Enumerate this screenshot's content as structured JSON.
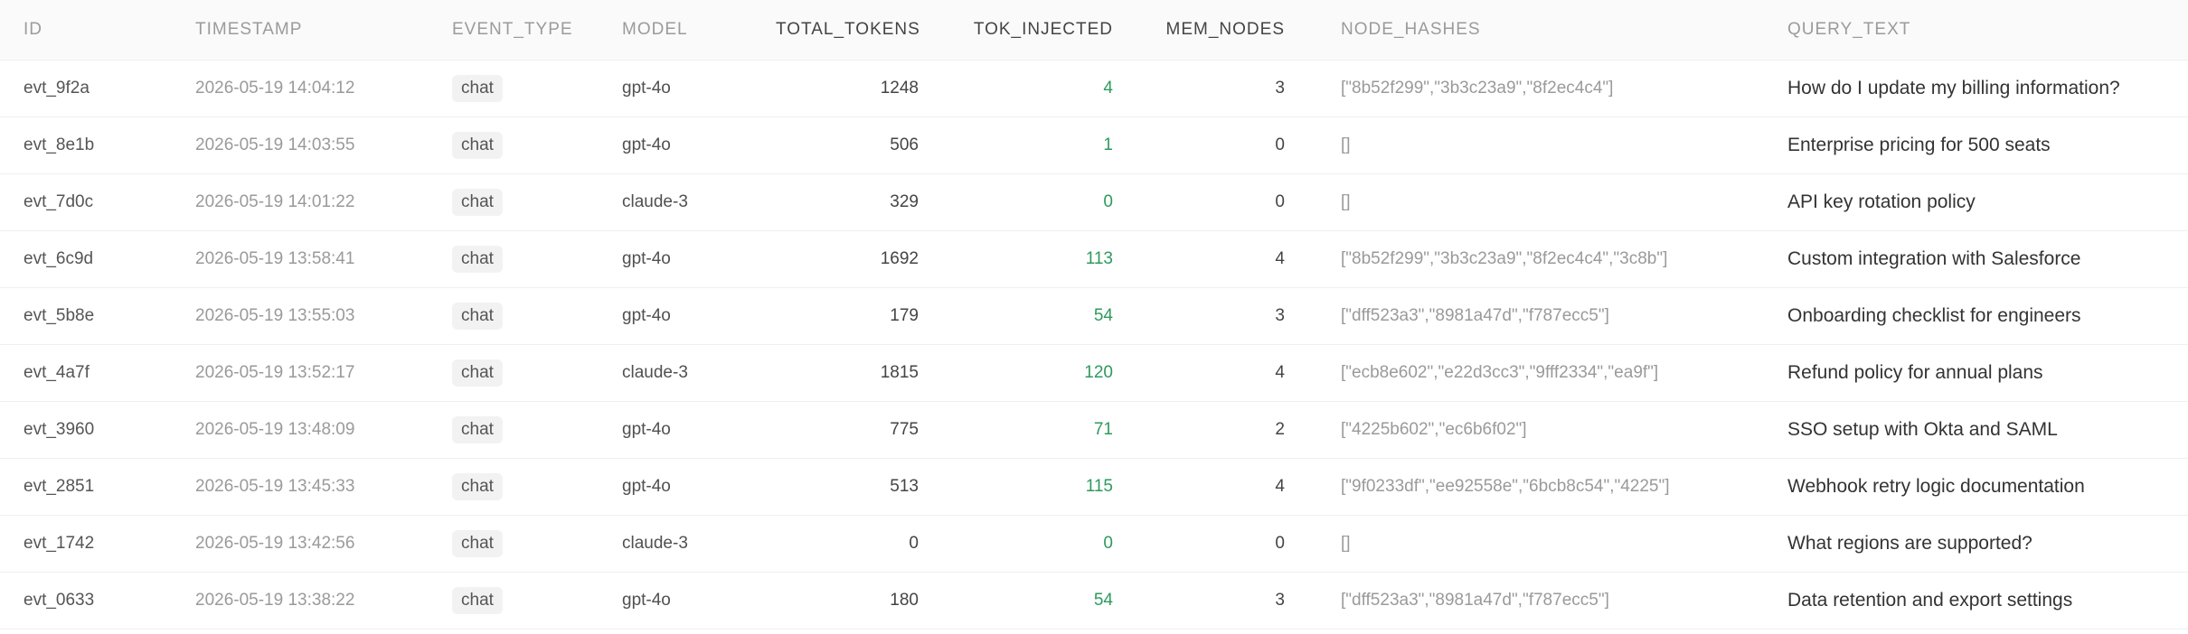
{
  "table": {
    "columns": {
      "id": "ID",
      "timestamp": "TIMESTAMP",
      "event_type": "EVENT_TYPE",
      "model": "MODEL",
      "total_tokens": "TOTAL_TOKENS",
      "tok_injected": "TOK_INJECTED",
      "mem_nodes": "MEM_NODES",
      "node_hashes": "NODE_HASHES",
      "query_text": "QUERY_TEXT"
    },
    "rows": [
      {
        "id": "evt_9f2a",
        "timestamp": "2026-05-19 14:04:12",
        "event_type": "chat",
        "model": "gpt-4o",
        "total_tokens": "1248",
        "tok_injected": "4",
        "mem_nodes": "3",
        "node_hashes": "[\"8b52f299\",\"3b3c23a9\",\"8f2ec4c4\"]",
        "query_text": "How do I update my billing information?"
      },
      {
        "id": "evt_8e1b",
        "timestamp": "2026-05-19 14:03:55",
        "event_type": "chat",
        "model": "gpt-4o",
        "total_tokens": "506",
        "tok_injected": "1",
        "mem_nodes": "0",
        "node_hashes": "[]",
        "query_text": "Enterprise pricing for 500 seats"
      },
      {
        "id": "evt_7d0c",
        "timestamp": "2026-05-19 14:01:22",
        "event_type": "chat",
        "model": "claude-3",
        "total_tokens": "329",
        "tok_injected": "0",
        "mem_nodes": "0",
        "node_hashes": "[]",
        "query_text": "API key rotation policy"
      },
      {
        "id": "evt_6c9d",
        "timestamp": "2026-05-19 13:58:41",
        "event_type": "chat",
        "model": "gpt-4o",
        "total_tokens": "1692",
        "tok_injected": "113",
        "mem_nodes": "4",
        "node_hashes": "[\"8b52f299\",\"3b3c23a9\",\"8f2ec4c4\",\"3c8b\"]",
        "query_text": "Custom integration with Salesforce"
      },
      {
        "id": "evt_5b8e",
        "timestamp": "2026-05-19 13:55:03",
        "event_type": "chat",
        "model": "gpt-4o",
        "total_tokens": "179",
        "tok_injected": "54",
        "mem_nodes": "3",
        "node_hashes": "[\"dff523a3\",\"8981a47d\",\"f787ecc5\"]",
        "query_text": "Onboarding checklist for engineers"
      },
      {
        "id": "evt_4a7f",
        "timestamp": "2026-05-19 13:52:17",
        "event_type": "chat",
        "model": "claude-3",
        "total_tokens": "1815",
        "tok_injected": "120",
        "mem_nodes": "4",
        "node_hashes": "[\"ecb8e602\",\"e22d3cc3\",\"9fff2334\",\"ea9f\"]",
        "query_text": "Refund policy for annual plans"
      },
      {
        "id": "evt_3960",
        "timestamp": "2026-05-19 13:48:09",
        "event_type": "chat",
        "model": "gpt-4o",
        "total_tokens": "775",
        "tok_injected": "71",
        "mem_nodes": "2",
        "node_hashes": "[\"4225b602\",\"ec6b6f02\"]",
        "query_text": "SSO setup with Okta and SAML"
      },
      {
        "id": "evt_2851",
        "timestamp": "2026-05-19 13:45:33",
        "event_type": "chat",
        "model": "gpt-4o",
        "total_tokens": "513",
        "tok_injected": "115",
        "mem_nodes": "4",
        "node_hashes": "[\"9f0233df\",\"ee92558e\",\"6bcb8c54\",\"4225\"]",
        "query_text": "Webhook retry logic documentation"
      },
      {
        "id": "evt_1742",
        "timestamp": "2026-05-19 13:42:56",
        "event_type": "chat",
        "model": "claude-3",
        "total_tokens": "0",
        "tok_injected": "0",
        "mem_nodes": "0",
        "node_hashes": "[]",
        "query_text": "What regions are supported?"
      },
      {
        "id": "evt_0633",
        "timestamp": "2026-05-19 13:38:22",
        "event_type": "chat",
        "model": "gpt-4o",
        "total_tokens": "180",
        "tok_injected": "54",
        "mem_nodes": "3",
        "node_hashes": "[\"dff523a3\",\"8981a47d\",\"f787ecc5\"]",
        "query_text": "Data retention and export settings"
      }
    ]
  },
  "colors": {
    "tok_injected": "#2e9a5e",
    "header_text": "#9b9b9b",
    "header_bg": "#fafafa",
    "badge_bg": "#f2f2f2"
  }
}
